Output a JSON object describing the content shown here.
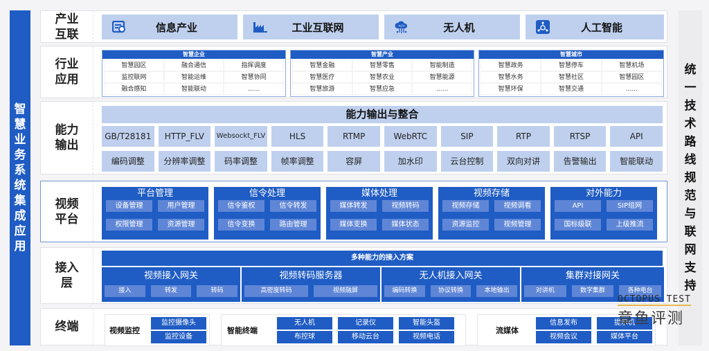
{
  "left_bar": {
    "text": [
      "智",
      "慧",
      "业",
      "务",
      "系",
      "统",
      "集",
      "成",
      "应",
      "用"
    ]
  },
  "right_bar": {
    "text": [
      "统",
      "一",
      "技",
      "术",
      "路",
      "线",
      "规",
      "范",
      "与",
      "联",
      "网",
      "支",
      "持"
    ]
  },
  "rows": {
    "industry": {
      "label": "产业\n互联",
      "items": [
        {
          "label": "信息产业",
          "icon": "info-card-icon"
        },
        {
          "label": "工业互联网",
          "icon": "factory-icon"
        },
        {
          "label": "无人机",
          "icon": "cloud-code-icon"
        },
        {
          "label": "人工智能",
          "icon": "ai-network-icon"
        }
      ]
    },
    "application": {
      "label": "行业\n应用",
      "groups": [
        {
          "title": "智慧企业",
          "items": [
            "智慧园区",
            "融合通信",
            "指挥调度",
            "监控联网",
            "智能运维",
            "智慧协同",
            "融合感知",
            "智能联动",
            "......"
          ]
        },
        {
          "title": "智慧产业",
          "items": [
            "智慧金融",
            "智慧零售",
            "智能制造",
            "智慧医疗",
            "智慧农业",
            "智慧能源",
            "智慧旅游",
            "智慧应急",
            "......"
          ]
        },
        {
          "title": "智慧城市",
          "items": [
            "智慧政务",
            "智慧停车",
            "智慧机场",
            "智慧水务",
            "智慧社区",
            "智慧园区",
            "智慧环保",
            "智慧交通",
            "......"
          ]
        }
      ]
    },
    "capability": {
      "label": "能力\n输出",
      "title": "能力输出与整合",
      "protocols": [
        "GB/T28181",
        "HTTP_FLV",
        "Websockt_FLV",
        "HLS",
        "RTMP",
        "WebRTC",
        "SIP",
        "RTP",
        "RTSP",
        "API"
      ],
      "functions": [
        "编码调整",
        "分辨率调整",
        "码率调整",
        "帧率调整",
        "容屏",
        "加水印",
        "云台控制",
        "双向对讲",
        "告警输出",
        "智能联动"
      ]
    },
    "platform": {
      "label": "视频\n平台",
      "groups": [
        {
          "title": "平台管理",
          "items": [
            "设备管理",
            "用户管理",
            "权限管理",
            "资源管理"
          ]
        },
        {
          "title": "信令处理",
          "items": [
            "信令鉴权",
            "信令转发",
            "信令变换",
            "路由管理"
          ]
        },
        {
          "title": "媒体处理",
          "items": [
            "媒体转发",
            "视频转码",
            "媒体变换",
            "媒体状态"
          ]
        },
        {
          "title": "视频存储",
          "items": [
            "视频存储",
            "视频调看",
            "资源监控",
            "视频管理"
          ]
        },
        {
          "title": "对外能力",
          "items": [
            "API",
            "SIP组网",
            "国标级联",
            "上级推流"
          ]
        }
      ]
    },
    "access": {
      "label": "接入\n层",
      "title": "多种能力的接入方案",
      "groups": [
        {
          "title": "视频接入网关",
          "items": [
            "接入",
            "转发",
            "转码"
          ]
        },
        {
          "title": "视频转码服务器",
          "items": [
            "高密度转码",
            "视频融屏"
          ]
        },
        {
          "title": "无人机接入网关",
          "items": [
            "编码转换",
            "协议转换",
            "本地输出"
          ]
        },
        {
          "title": "集群对接网关",
          "items": [
            "对讲机",
            "数字集群",
            "各种电台"
          ]
        }
      ]
    },
    "terminal": {
      "label": "终端",
      "groups": [
        {
          "title": "视频监控",
          "items": [
            "监控摄像头",
            "监控设备"
          ]
        },
        {
          "title": "智能终端",
          "items": [
            "无人机",
            "记录仪",
            "智能头盔",
            "布控球",
            "移动云台",
            "视频电话"
          ]
        },
        {
          "title": "流媒体",
          "items": [
            "信息发布",
            "提示机",
            "视频会议",
            "媒体平台"
          ]
        }
      ]
    }
  },
  "watermark": {
    "en": "OCTOPUS TEST",
    "cn": "章鱼评测"
  }
}
